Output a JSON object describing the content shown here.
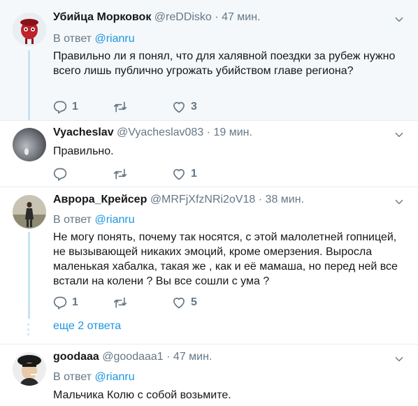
{
  "tweets": [
    {
      "name": "Убийца Морковок",
      "handle": "@reDDisko",
      "sep": "·",
      "time": "47 мин.",
      "reply_prefix": "В ответ",
      "reply_to": "@rianru",
      "text": "Правильно ли я понял, что для халявной поездки за рубеж нужно всего лишь публично угрожать убийством главе региона?",
      "replies": "1",
      "retweets": "",
      "likes": "3"
    },
    {
      "name": "Vyacheslav",
      "handle": "@Vyacheslav083",
      "sep": "·",
      "time": "19 мин.",
      "text": "Правильно.",
      "replies": "",
      "retweets": "",
      "likes": "1"
    },
    {
      "name": "Аврора_Крейсер",
      "handle": "@MRFjXfzNRi2oV18",
      "sep": "·",
      "time": "38 мин.",
      "reply_prefix": "В ответ",
      "reply_to": "@rianru",
      "text": "Не могу понять, почему так носятся, с этой малолетней гопницей, не вызывающей никаких эмоций, кроме омерзения. Выросла маленькая хабалка, такая же , как и её мамаша, но перед ней все встали на колени ? Вы все сошли с ума ?",
      "replies": "1",
      "retweets": "",
      "likes": "5",
      "more_replies": "еще 2 ответа"
    },
    {
      "name": "goodaaa",
      "handle": "@goodaaa1",
      "sep": "·",
      "time": "47 мин.",
      "reply_prefix": "В ответ",
      "reply_to": "@rianru",
      "text": "Мальчика Колю с собой возьмите."
    }
  ],
  "icons": {
    "reply": "reply-icon",
    "retweet": "retweet-icon",
    "like": "heart-icon",
    "caret": "chevron-down-icon"
  },
  "colors": {
    "link": "#1b95e0",
    "muted": "#657786",
    "thread_line": "#c4e4f6",
    "highlight_bg": "#f5f8fa"
  }
}
